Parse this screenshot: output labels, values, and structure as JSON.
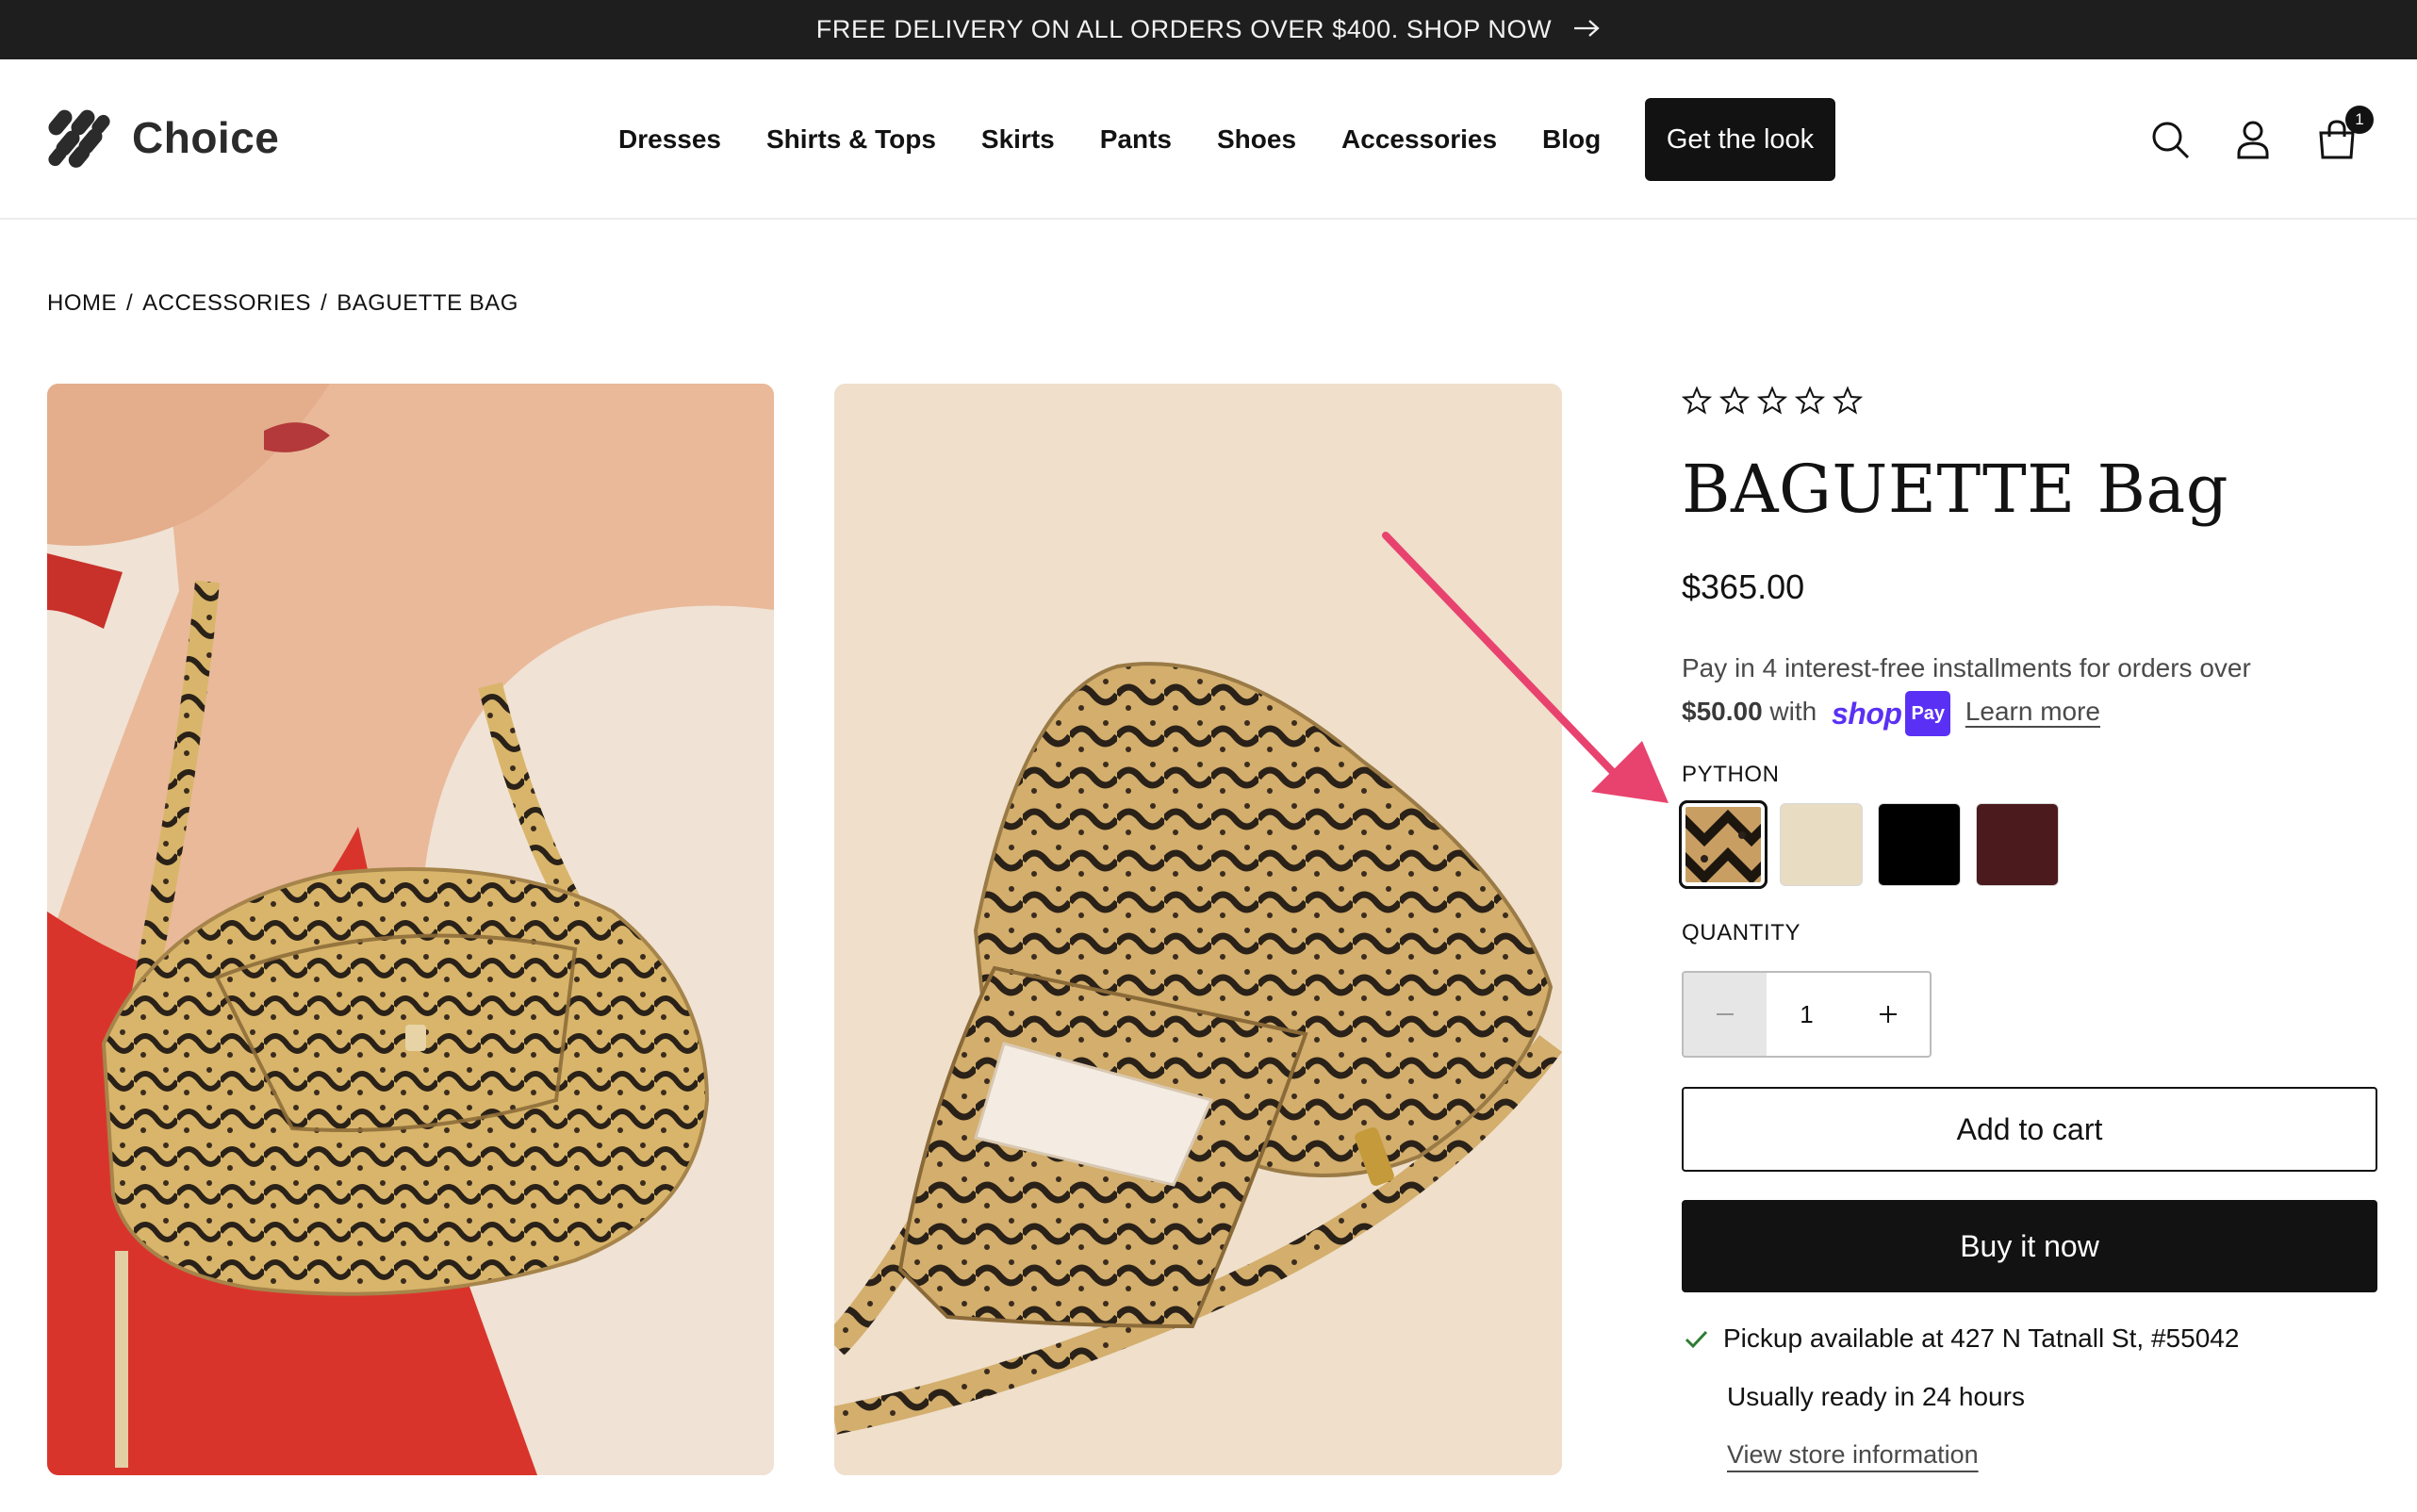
{
  "announcement": {
    "text": "FREE DELIVERY ON ALL ORDERS OVER $400. SHOP NOW",
    "icon": "arrow-right-icon"
  },
  "header": {
    "logo_text": "Choice",
    "nav": [
      "Dresses",
      "Shirts & Tops",
      "Skirts",
      "Pants",
      "Shoes",
      "Accessories",
      "Blog"
    ],
    "cta_label": "Get the look",
    "icons": [
      "search-icon",
      "account-icon",
      "cart-icon"
    ],
    "cart_count": "1"
  },
  "breadcrumb": [
    "HOME",
    "ACCESSORIES",
    "BAGUETTE BAG"
  ],
  "breadcrumb_separator": "/",
  "product": {
    "rating_stars": 5,
    "title": "BAGUETTE Bag",
    "price": "$365.00",
    "installments_text": "Pay in 4 interest-free installments for orders over",
    "installments_amount": "$50.00",
    "installments_with": "with",
    "shoppay_word": "shop",
    "shoppay_badge": "Pay",
    "learn_more": "Learn more",
    "color_label": "PYTHON",
    "swatches": [
      {
        "name": "python",
        "color": "#b48f5f",
        "selected": true
      },
      {
        "name": "cream",
        "color": "#e8dcc3",
        "selected": false
      },
      {
        "name": "black",
        "color": "#000000",
        "selected": false
      },
      {
        "name": "burgundy",
        "color": "#4a1a1d",
        "selected": false
      }
    ],
    "quantity_label": "QUANTITY",
    "quantity": "1",
    "add_to_cart": "Add to cart",
    "buy_now": "Buy it now",
    "pickup_text": "Pickup available at 427 N Tatnall St, #55042",
    "ready_text": "Usually ready in 24 hours",
    "store_link": "View store information"
  },
  "colors": {
    "dark": "#121212",
    "announce_bg": "#1e1e1f",
    "shoppay": "#5a31f4",
    "arrow": "#e8436f",
    "check": "#2e7d32"
  }
}
